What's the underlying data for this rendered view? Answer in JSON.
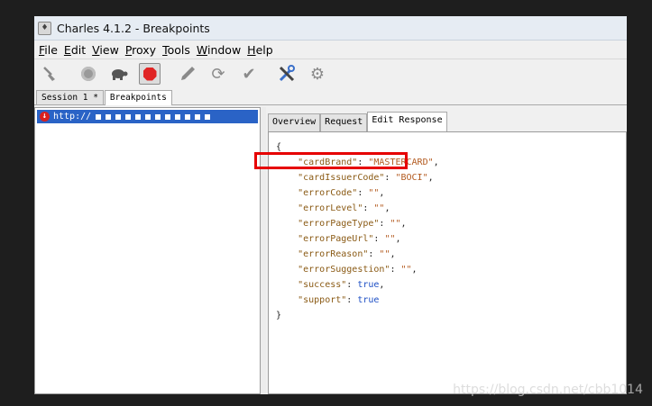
{
  "window": {
    "title": "Charles 4.1.2 - Breakpoints"
  },
  "menu": [
    {
      "mnemonic": "F",
      "rest": "ile"
    },
    {
      "mnemonic": "E",
      "rest": "dit"
    },
    {
      "mnemonic": "V",
      "rest": "iew"
    },
    {
      "mnemonic": "P",
      "rest": "roxy"
    },
    {
      "mnemonic": "T",
      "rest": "ools"
    },
    {
      "mnemonic": "W",
      "rest": "indow"
    },
    {
      "mnemonic": "H",
      "rest": "elp"
    }
  ],
  "toolbar": {
    "icons": [
      "broom-icon",
      "record-icon",
      "throttle-turtle-icon",
      "breakpoints-stop-icon",
      "pen-icon",
      "refresh-icon",
      "checkmark-icon",
      "tools-icon",
      "settings-gear-icon"
    ]
  },
  "session_tabs": [
    {
      "label": "Session 1 *"
    },
    {
      "label": "Breakpoints",
      "selected": true
    }
  ],
  "tree": {
    "row_label": "http://"
  },
  "detail_tabs": [
    {
      "label": "Overview"
    },
    {
      "label": "Request"
    },
    {
      "label": "Edit Response",
      "selected": true
    }
  ],
  "json_body": {
    "open": "{",
    "close": "}",
    "lines": [
      {
        "key": "\"cardBrand\"",
        "value": "\"MASTERCARD\"",
        "comma": ","
      },
      {
        "key": "\"cardIssuerCode\"",
        "value": "\"BOCI\"",
        "comma": ","
      },
      {
        "key": "\"errorCode\"",
        "value": "\"\"",
        "comma": ","
      },
      {
        "key": "\"errorLevel\"",
        "value": "\"\"",
        "comma": ","
      },
      {
        "key": "\"errorPageType\"",
        "value": "\"\"",
        "comma": ","
      },
      {
        "key": "\"errorPageUrl\"",
        "value": "\"\"",
        "comma": ","
      },
      {
        "key": "\"errorReason\"",
        "value": "\"\"",
        "comma": ","
      },
      {
        "key": "\"errorSuggestion\"",
        "value": "\"\"",
        "comma": ","
      },
      {
        "key": "\"success\"",
        "value": "true",
        "comma": ","
      },
      {
        "key": "\"support\"",
        "value": "true",
        "comma": ""
      }
    ]
  },
  "watermark": "https://blog.csdn.net/cbb1014",
  "colors": {
    "highlight": "#e60000",
    "selection": "#2a63c6",
    "stop": "#e02424"
  }
}
